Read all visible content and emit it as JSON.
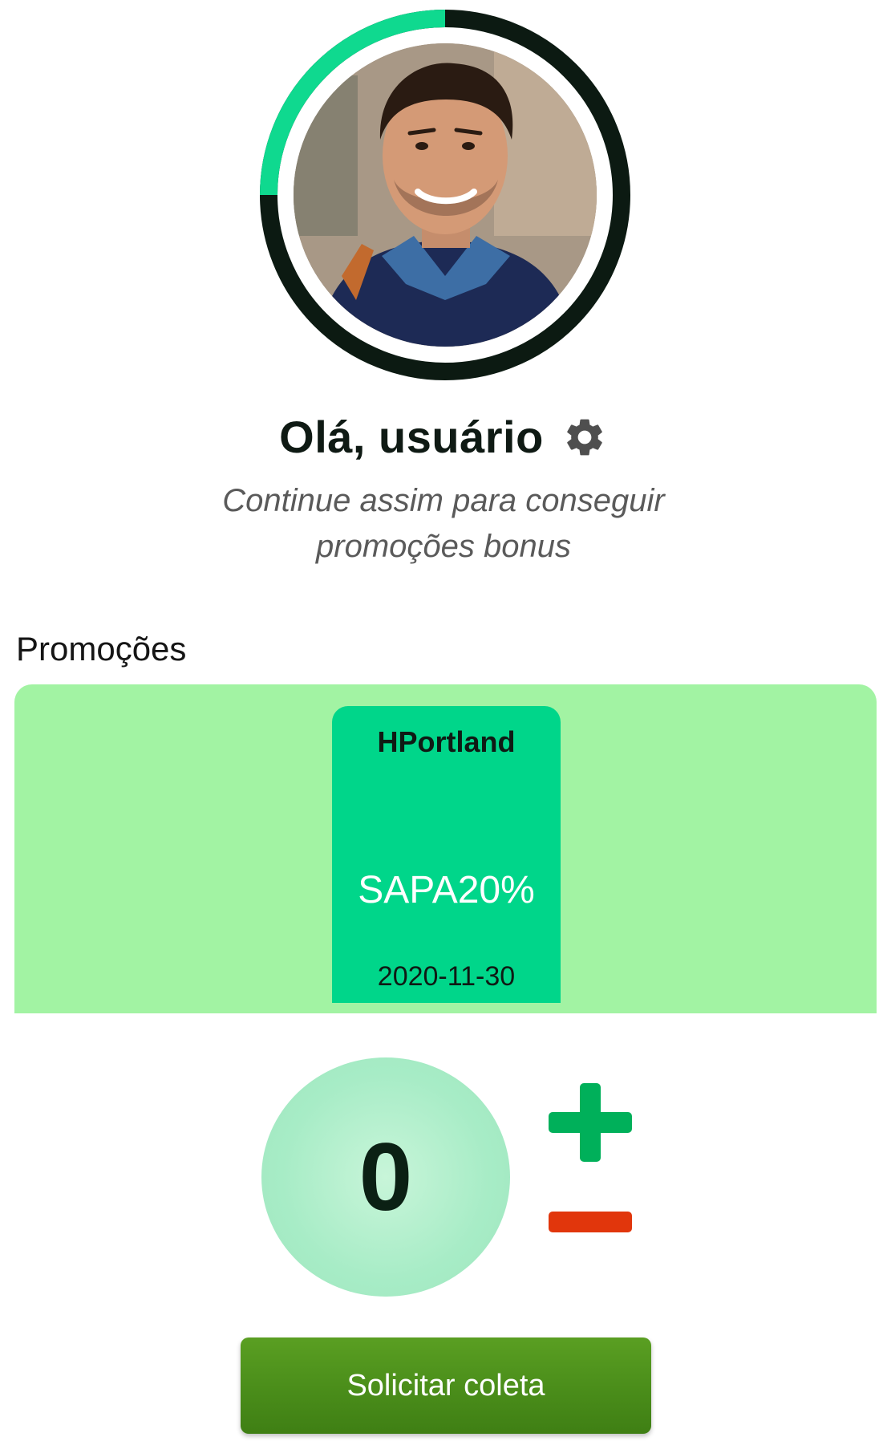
{
  "profile": {
    "avatar_icon": "user-photo",
    "progress_fraction": 0.25,
    "progress_color": "#0fd98f",
    "ring_color": "#0c1a12"
  },
  "header": {
    "greeting": "Olá, usuário",
    "settings_icon": "gear-icon",
    "subtitle_line1": "Continue assim para conseguir",
    "subtitle_line2": "promoções bonus"
  },
  "promotions": {
    "title": "Promoções",
    "panel_color": "#a2f3a3",
    "items": [
      {
        "store": "HPortland",
        "code": "SAPA20%",
        "date": "2020-11-30",
        "color": "#00d68a"
      }
    ]
  },
  "counter": {
    "value": "0",
    "plus_icon": "plus-icon",
    "minus_icon": "minus-icon",
    "plus_color": "#00b05a",
    "minus_color": "#e1360c"
  },
  "actions": {
    "request_label": "Solicitar coleta",
    "request_color": "#4a8d1a"
  }
}
